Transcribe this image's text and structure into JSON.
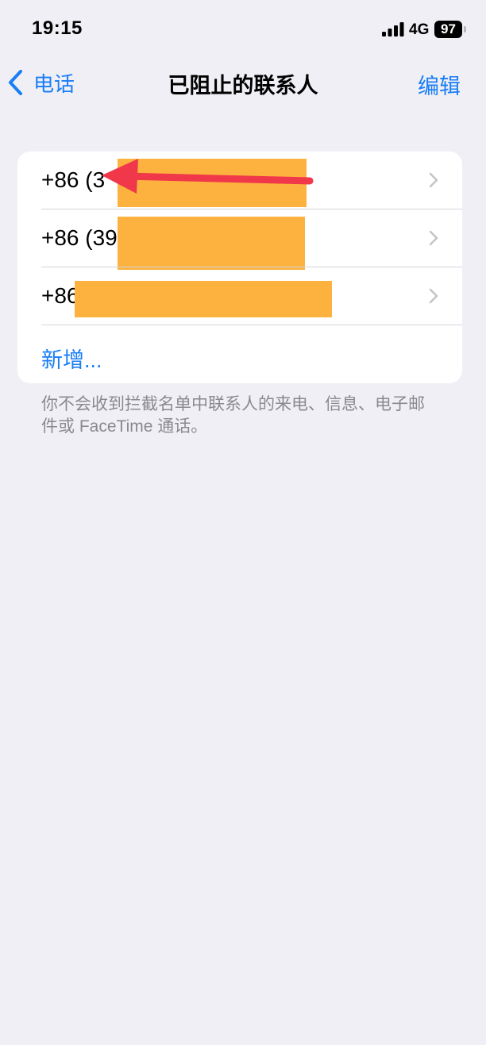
{
  "status_bar": {
    "time": "19:15",
    "network": "4G",
    "battery": "97",
    "icons": [
      "signal-bars-icon",
      "battery-icon"
    ]
  },
  "nav": {
    "back_label": "电话",
    "back_icon": "chevron-left-icon",
    "title": "已阻止的联系人",
    "edit_label": "编辑"
  },
  "blocked_contacts": [
    {
      "number": "+86 (3",
      "redacted": true
    },
    {
      "number": "+86 (39",
      "redacted": true
    },
    {
      "number": "+86",
      "redacted": true
    }
  ],
  "add_label": "新增...",
  "footer": "你不会收到拦截名单中联系人的来电、信息、电子邮件或 FaceTime 通话。",
  "colors": {
    "accent": "#1a7ef5",
    "background": "#f0eff5",
    "redaction": "#fdb240",
    "annotation_arrow": "#f0384a",
    "secondary_text": "#8a8a8e"
  }
}
